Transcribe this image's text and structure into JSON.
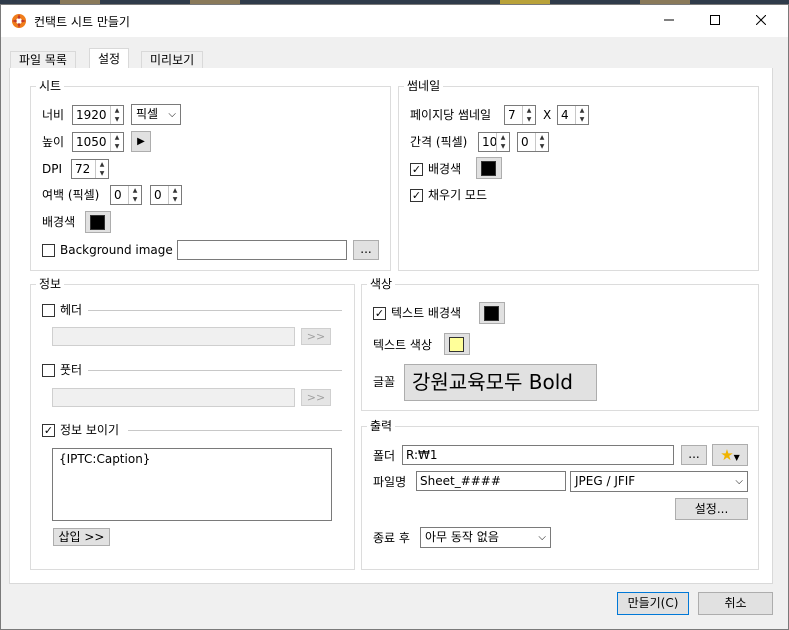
{
  "window": {
    "title": "컨택트 시트 만들기",
    "minimize_icon": "minimize-icon",
    "maximize_icon": "maximize-icon",
    "close_icon": "close-icon"
  },
  "tabs": [
    {
      "label": "파일 목록",
      "active": false
    },
    {
      "label": "설정",
      "active": true
    },
    {
      "label": "미리보기",
      "active": false
    }
  ],
  "sheet": {
    "group_label": "시트",
    "width_label": "너비",
    "width_value": "1920",
    "unit_value": "픽셀",
    "height_label": "높이",
    "height_value": "1050",
    "dpi_label": "DPI",
    "dpi_value": "72",
    "margin_label": "여백 (픽셀)",
    "margin_x": "0",
    "margin_y": "0",
    "bg_label": "배경색",
    "bg_color": "#000000",
    "bg_image_label": "Background image",
    "bg_image_checked": false,
    "bg_image_value": "",
    "browse_label": "..."
  },
  "thumbnail": {
    "group_label": "썸네일",
    "per_page_label": "페이지당 썸네일",
    "cols": "7",
    "x_label": "X",
    "rows": "4",
    "spacing_label": "간격 (픽셀)",
    "spacing_x": "10",
    "spacing_y": "0",
    "bg_label": "배경색",
    "bg_checked": true,
    "bg_color": "#000000",
    "fill_label": "채우기 모드",
    "fill_checked": true
  },
  "info": {
    "group_label": "정보",
    "header_label": "헤더",
    "header_checked": false,
    "header_btn": ">>",
    "footer_label": "풋터",
    "footer_checked": false,
    "footer_btn": ">>",
    "show_label": "정보 보이기",
    "show_checked": true,
    "text": "{IPTC:Caption}",
    "insert_label": "삽입 >>"
  },
  "color": {
    "group_label": "색상",
    "text_bg_label": "텍스트 배경색",
    "text_bg_checked": true,
    "text_bg_color": "#000000",
    "text_color_label": "텍스트 색상",
    "text_color": "#ffff99",
    "font_label": "글꼴",
    "font_value": "강원교육모두 Bold"
  },
  "output": {
    "group_label": "출력",
    "folder_label": "폴더",
    "folder_value": "R:₩1",
    "browse_label": "...",
    "favorite_icon": "star-icon",
    "filename_label": "파일명",
    "filename_value": "Sheet_####",
    "format_value": "JPEG / JFIF",
    "settings_label": "설정...",
    "after_label": "종료 후",
    "after_value": "아무 동작 없음"
  },
  "footer": {
    "create_label": "만들기(C)",
    "cancel_label": "취소"
  }
}
